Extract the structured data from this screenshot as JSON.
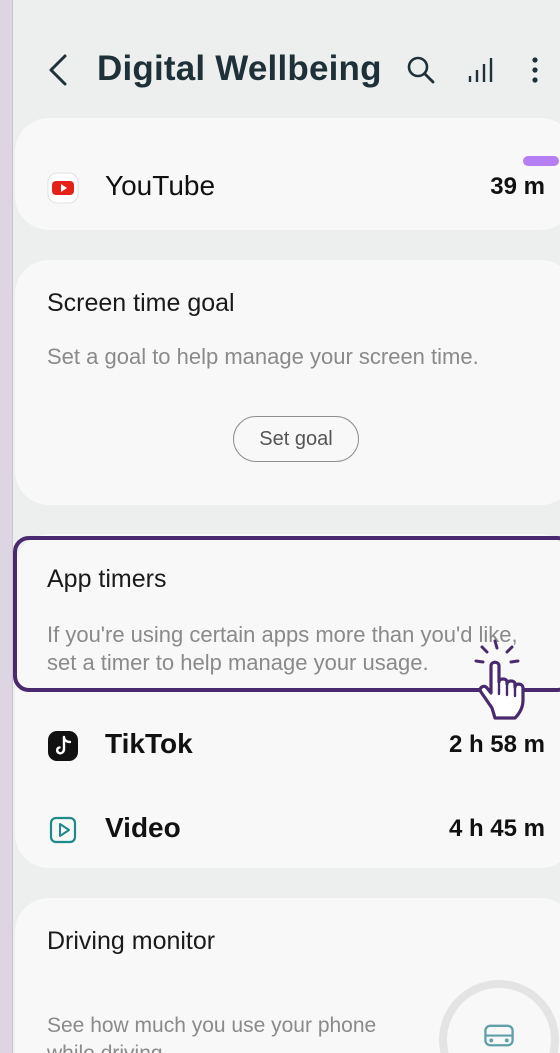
{
  "header": {
    "title": "Digital Wellbeing",
    "back_icon": "chevron-left-icon",
    "search_icon": "search-icon",
    "chart_icon": "bar-chart-icon",
    "more_icon": "more-vertical-icon"
  },
  "most_used": {
    "app": {
      "name": "YouTube",
      "time": "39 m",
      "icon": "youtube-icon",
      "bar_color": "#b57ef2"
    }
  },
  "screen_time_goal": {
    "title": "Screen time goal",
    "description": "Set a goal to help manage your screen time.",
    "button_label": "Set goal"
  },
  "app_timers": {
    "title": "App timers",
    "description": "If you're using certain apps more than you'd like, set a timer to help manage your usage.",
    "apps": [
      {
        "name": "TikTok",
        "time": "2 h 58 m",
        "icon": "tiktok-icon"
      },
      {
        "name": "Video",
        "time": "4 h 45 m",
        "icon": "video-play-icon"
      }
    ]
  },
  "driving_monitor": {
    "title": "Driving monitor",
    "description": "See how much you use your phone while driving.",
    "icon": "car-icon"
  },
  "colors": {
    "background": "#ecefee",
    "card": "#f8f8f8",
    "highlight_border": "#4a2a6e",
    "accent": "#b57ef2"
  }
}
